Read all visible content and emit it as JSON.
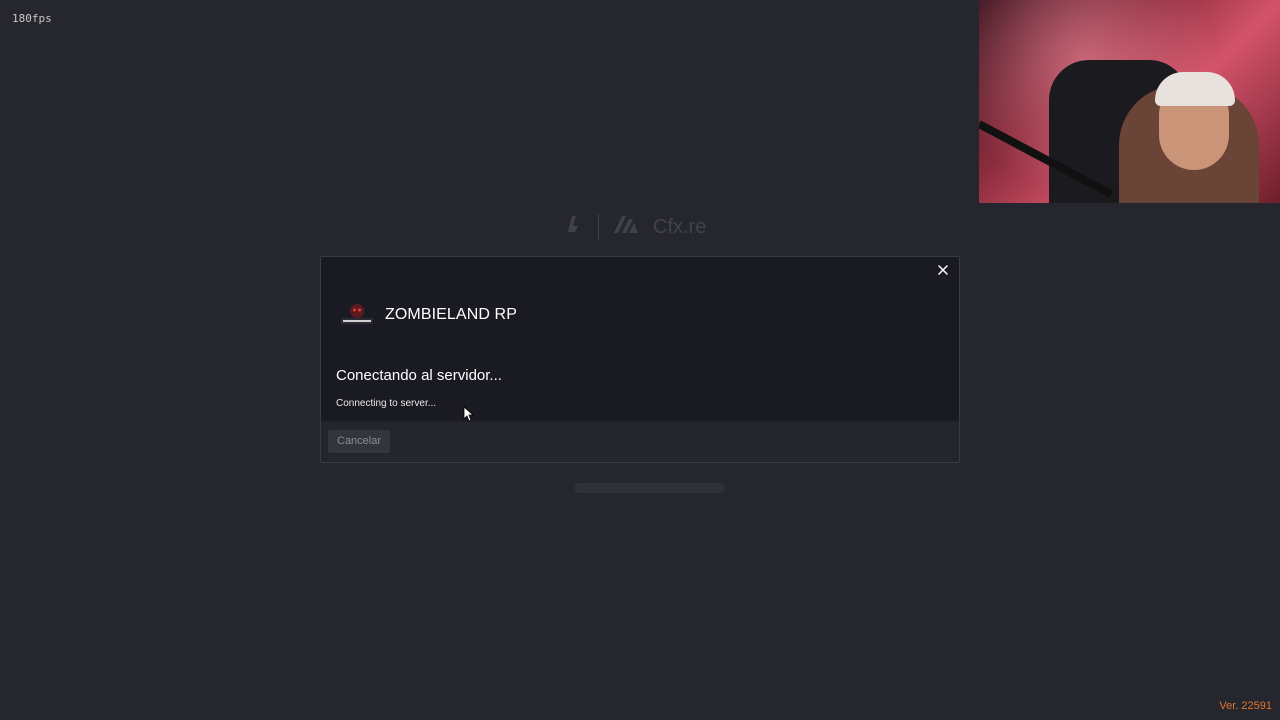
{
  "overlay": {
    "fps": "180fps"
  },
  "background": {
    "brand_text": "Cfx.re"
  },
  "modal": {
    "server_logo_icon": "zombieland-logo-icon",
    "server_name": "ZOMBIELAND RP",
    "status_title": "Conectando al servidor...",
    "status_detail": "Connecting to server...",
    "cancel_label": "Cancelar",
    "close_icon": "close-icon"
  },
  "footer": {
    "version": "Ver. 22591"
  },
  "colors": {
    "background": "#26272e",
    "modal": "#1a1b22",
    "footer": "#25262d",
    "version": "#e2752c"
  }
}
